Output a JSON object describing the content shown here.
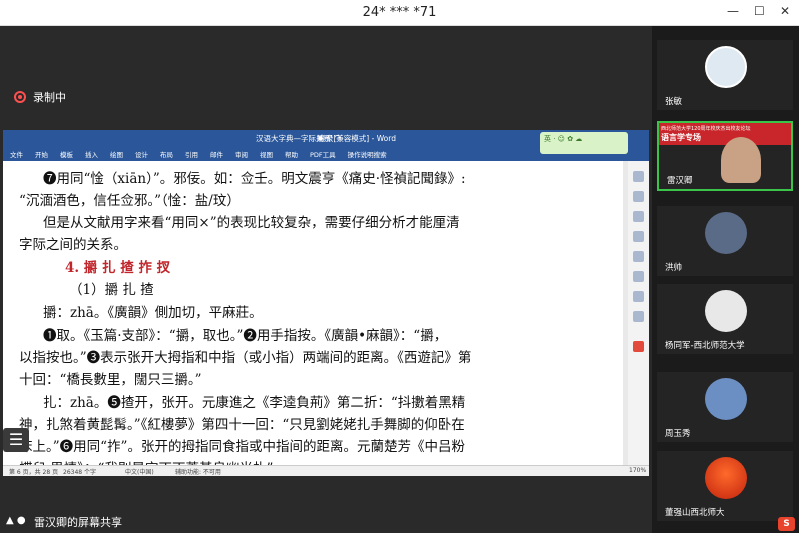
{
  "window": {
    "title": "24* *** *71"
  },
  "recording": {
    "label": "录制中"
  },
  "word": {
    "title": "汉语大字典—字际关系 [兼容模式] - Word",
    "login": "登录",
    "menu": [
      "文件",
      "开始",
      "模板",
      "插入",
      "绘图",
      "设计",
      "布局",
      "引用",
      "邮件",
      "审阅",
      "视图",
      "帮助",
      "PDF工具",
      "操作说明搜索"
    ],
    "lines": [
      "❼用同“惍（xiān）”。邪佞。如：佥壬。明文震亨《痛史·怪禎記聞錄》:",
      "“沉湎酒色，信任佥邪。”（惍：盐/玟）",
      "但是从文献用字来看“用同×”的表现比较复杂，需要仔细分析才能厘清",
      "字际之间的关系。",
      "4. 㩱 扎 揸 拃 扠",
      "（1）㩱 扎 揸",
      "㩱：zhā。《廣韻》側加切，平麻莊。",
      "❶取。《玉篇·支部》：“㩱，取也。”❷用手指按。《廣韻•麻韻》：“㩱，",
      "以指按也。”❸表示张开大拇指和中指（或小指）两端间的距离。《西遊記》第",
      "十回：“橋長數里，闊只三㩱。”",
      "扎：zhā。❺揸开，张开。元康進之《李逵負荊》第二折：“抖擻着黑精",
      "神，扎煞着黄髭髯。”《紅樓夢》第四十一回：“只見劉姥姥扎手舞脚的仰卧在",
      "床上。”❻用同“拃”。张开的拇指同食指或中指间的距离。元蘭楚芳《中吕粉",
      "蝶兒·思情》：“我則是空丁丁蓋基良幽光扎”"
    ],
    "status": {
      "page": "第 6 页，共 28 页",
      "words": "26348 个字",
      "lang": "中文(中国)",
      "access": "辅助功能: 不可用",
      "zoom": "170%"
    }
  },
  "share": {
    "label": "雷汉卿的屏幕共享"
  },
  "participants": [
    {
      "name": "张敏"
    },
    {
      "name": "雷汉卿",
      "banner": "西北师范大学120周年校庆杰出校友论坛",
      "sub": "语言学专场"
    },
    {
      "name": "洪帅"
    },
    {
      "name": "杨同军-西北师范大学"
    },
    {
      "name": "周玉秀"
    },
    {
      "name": "董强山西北师大"
    }
  ],
  "colors": {
    "word_blue": "#2b579a",
    "red_text": "#c0262b"
  }
}
